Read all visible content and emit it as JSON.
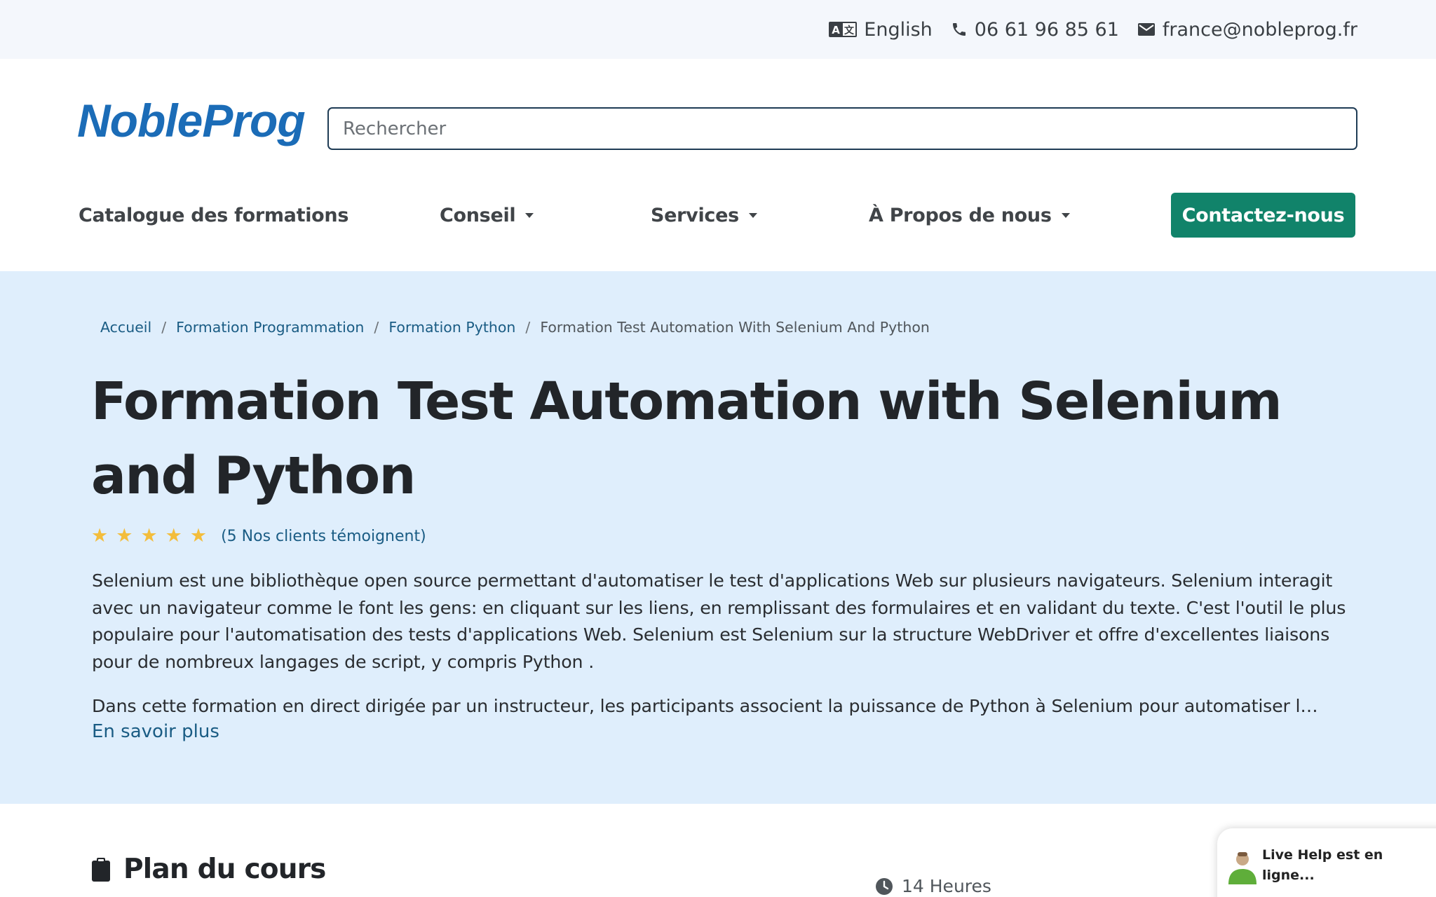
{
  "topbar": {
    "language": "English",
    "phone": "06 61 96 85 61",
    "email": "france@nobleprog.fr"
  },
  "header": {
    "logo": "NobleProg",
    "search_placeholder": "Rechercher"
  },
  "nav": {
    "catalogue": "Catalogue des formations",
    "conseil": "Conseil",
    "services": "Services",
    "apropos": "À Propos de nous",
    "contact": "Contactez-nous"
  },
  "breadcrumb": {
    "items": [
      "Accueil",
      "Formation Programmation",
      "Formation Python"
    ],
    "current": "Formation Test Automation With Selenium And Python",
    "separator": "/"
  },
  "course": {
    "title": "Formation Test Automation with Selenium and Python",
    "rating_stars": 5,
    "rating_text": "(5 Nos clients témoignent)",
    "description": "Selenium est une bibliothèque open source permettant d'automatiser le test d'applications Web sur plusieurs navigateurs. Selenium interagit avec un navigateur comme le font les gens: en cliquant sur les liens, en remplissant des formulaires et en validant du texte. C'est l'outil le plus populaire pour l'automatisation des tests d'applications Web. Selenium est Selenium sur la structure WebDriver et offre d'excellentes liaisons pour de nombreux langages de script, y compris Python .",
    "description_2": "Dans cette formation en direct dirigée par un instructeur, les participants associent la puissance de Python à Selenium pour automatiser l…",
    "read_more": "En savoir plus"
  },
  "plan": {
    "title": "Plan du cours",
    "duration": "14 Heures"
  },
  "livehelp": {
    "text": "Live Help est en ligne..."
  },
  "colors": {
    "brand_blue": "#1b6cb7",
    "cta_green": "#11836a",
    "hero_bg": "#dfeefc",
    "link": "#1a5c84",
    "star": "#f3bd3c"
  },
  "icons": {
    "language": "translate-icon",
    "phone": "phone-icon",
    "email": "envelope-icon",
    "plan": "clipboard-icon",
    "duration": "clock-icon",
    "star": "star-icon",
    "livehelp": "agent-avatar-icon"
  }
}
